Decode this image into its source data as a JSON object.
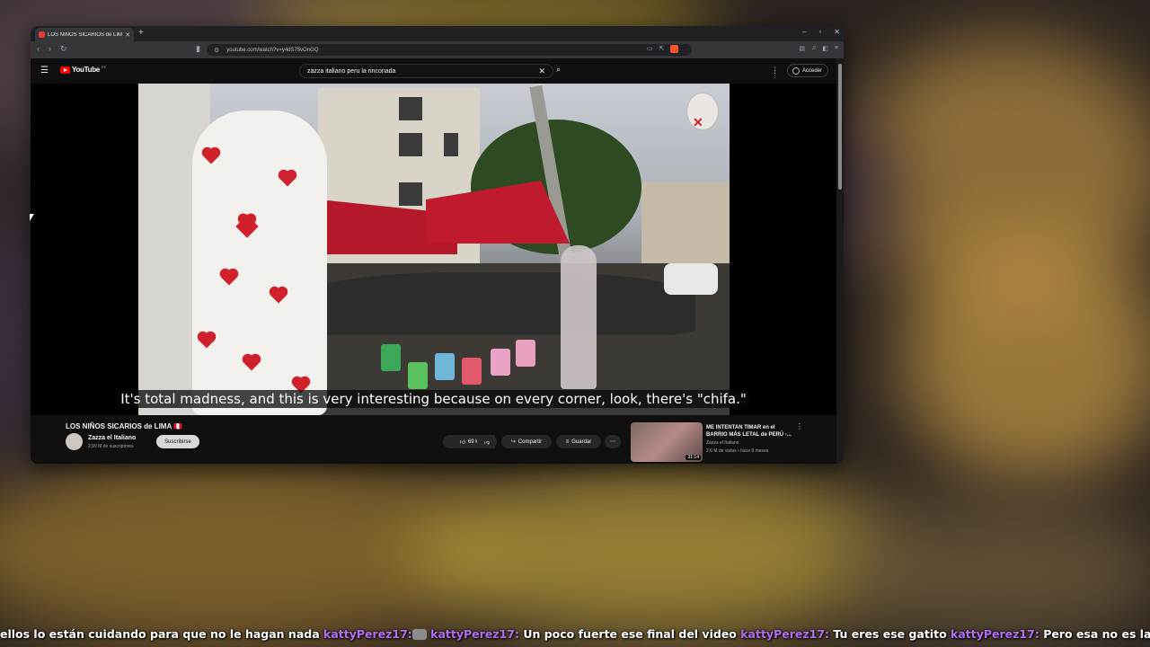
{
  "browser": {
    "tab_title": "LOS NIÑOS SICARIOS de LIMA",
    "new_tab": "+",
    "url": "youtube.com/watch?v=y4dS75vOnGQ",
    "window_controls": [
      "–",
      "▫",
      "✕"
    ]
  },
  "youtube": {
    "logo_text": "YouTube",
    "logo_country": "PE",
    "search_value": "zazza italiano peru la rinconada",
    "signin_label": "Acceder"
  },
  "video": {
    "subtitle": "It's total madness, and this is very interesting because on every corner, look, there's \"chifa.\"",
    "title": "LOS NIÑOS SICARIOS de LIMA 🇵🇪",
    "channel": "Zazza el Italiano",
    "subscribers": "2,99 M de suscriptores",
    "subscribe_label": "Suscribirse",
    "likes": "69 k",
    "share_label": "Compartir",
    "save_label": "Guardar"
  },
  "related": {
    "title": "ME INTENTAN TIMAR en el BARRIO MÁS LETAL de PERÚ -...",
    "channel": "Zazza el Italiano",
    "meta": "2,6 M de vistas • hace 9 meses",
    "duration": "31:14"
  },
  "chat": [
    {
      "type": "text",
      "text": "ellos lo están cuidando para que no le hagan nada "
    },
    {
      "type": "user",
      "text": "kattyPerez17:"
    },
    {
      "type": "emote",
      "name": "cat-emote"
    },
    {
      "type": "user",
      "text": " kattyPerez17:"
    },
    {
      "type": "text",
      "text": " Un poco fuerte ese final del video "
    },
    {
      "type": "user",
      "text": "kattyPerez17:"
    },
    {
      "type": "text",
      "text": " Tu eres ese gatito "
    },
    {
      "type": "user",
      "text": "kattyPerez17:"
    },
    {
      "type": "text",
      "text": " Pero esa no es la rinconada"
    }
  ]
}
